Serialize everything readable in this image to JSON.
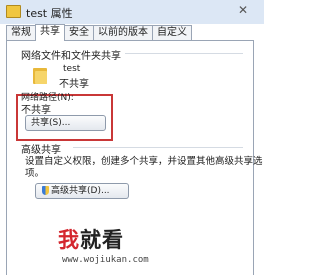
{
  "window": {
    "title": "test 属性",
    "close_glyph": "✕"
  },
  "tabs": [
    {
      "label": "常规"
    },
    {
      "label": "共享"
    },
    {
      "label": "安全"
    },
    {
      "label": "以前的版本"
    },
    {
      "label": "自定义"
    }
  ],
  "network_sharing": {
    "heading": "网络文件和文件夹共享",
    "folder_name": "test",
    "folder_status": "不共享",
    "path_label": "网络路径(N):",
    "path_value": "不共享",
    "share_button": "共享(S)..."
  },
  "advanced_sharing": {
    "heading": "高级共享",
    "description_line1": "设置自定义权限，创建多个共享，并设置其他高级共享选",
    "description_line2": "项。",
    "button": "高级共享(D)..."
  },
  "watermark": {
    "char1": "我",
    "char2": "就看",
    "url": "www.wojiukan.com"
  },
  "icons": {
    "folder": "folder-icon",
    "shield": "uac-shield-icon"
  }
}
